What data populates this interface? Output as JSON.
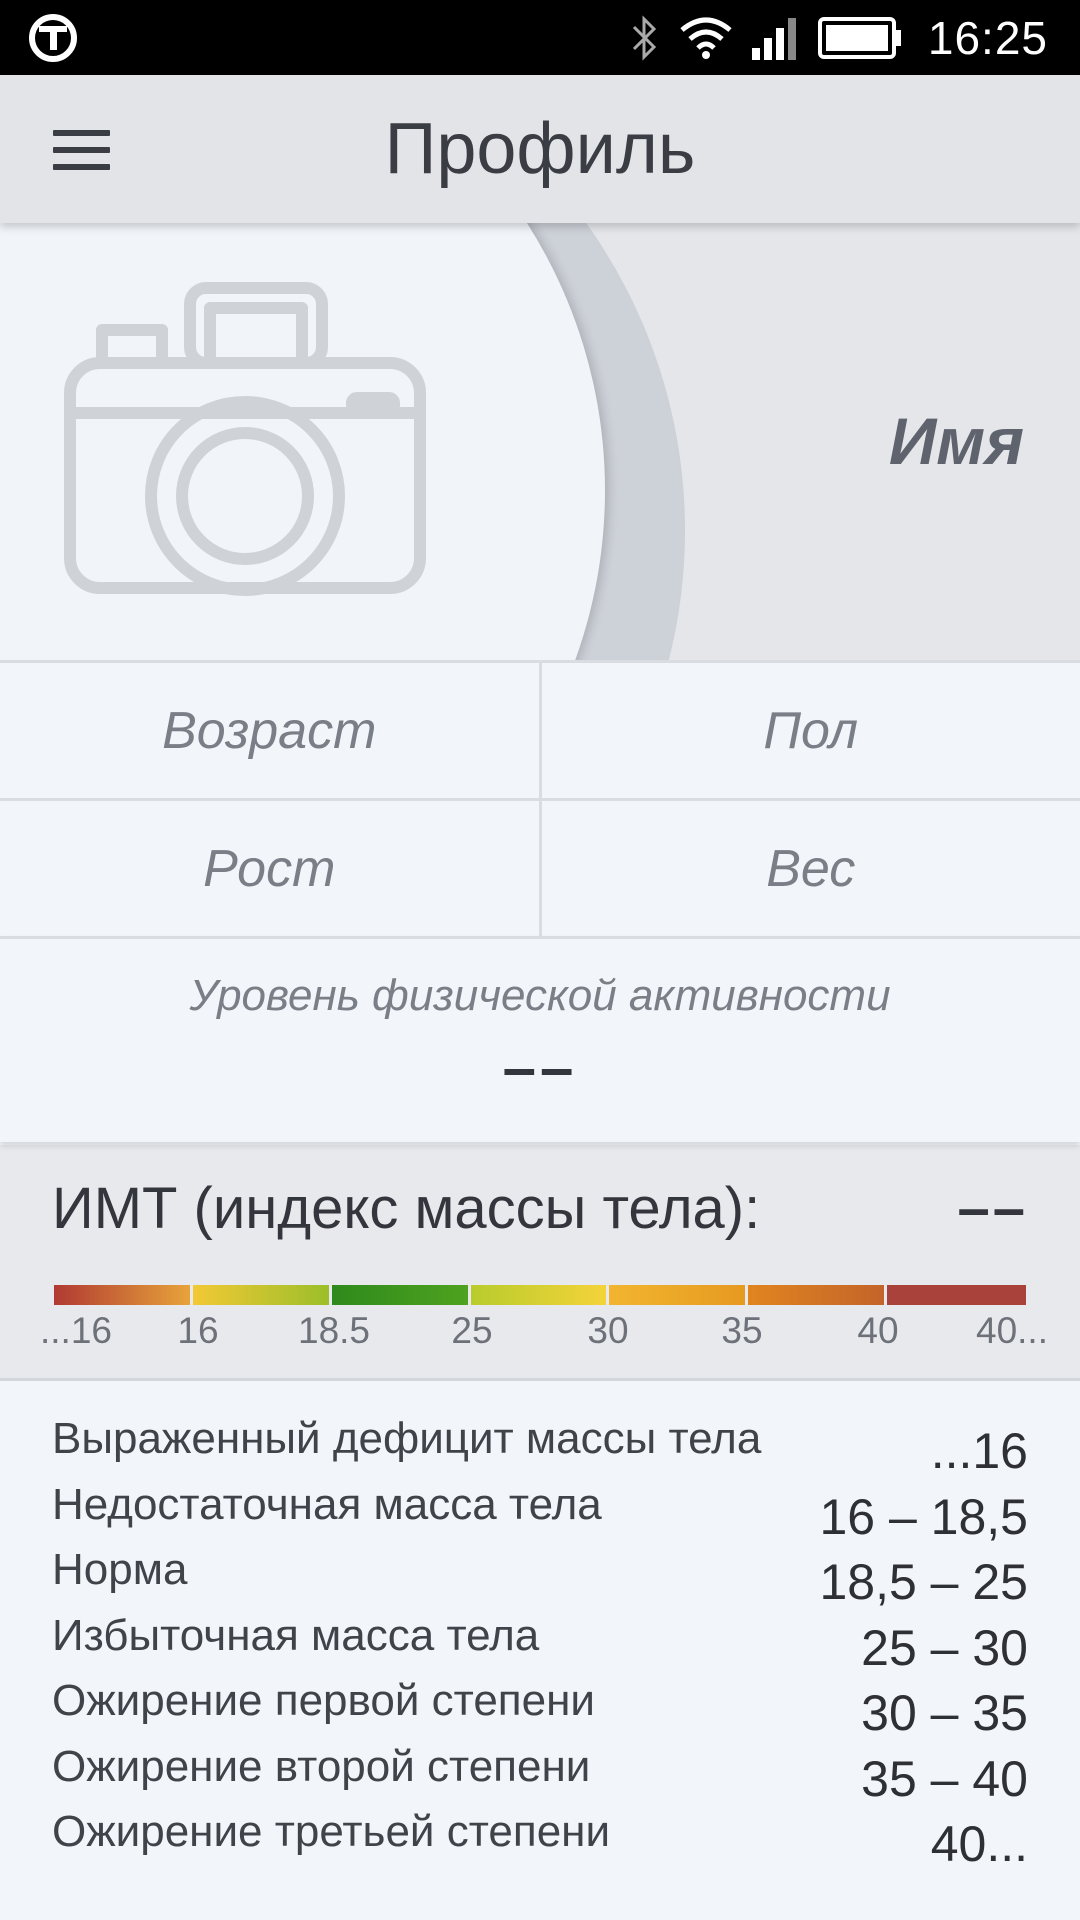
{
  "status_bar": {
    "time": "16:25",
    "icons": [
      "app-logo-icon",
      "bluetooth-icon",
      "wifi-icon",
      "signal-icon",
      "battery-icon"
    ]
  },
  "app_bar": {
    "title": "Профиль",
    "menu_icon": "menu-icon"
  },
  "profile": {
    "photo_icon": "camera-icon",
    "name": "Имя",
    "fields": {
      "age": "Возраст",
      "gender": "Пол",
      "height": "Рост",
      "weight": "Вес"
    },
    "activity": {
      "label": "Уровень физической активности",
      "value": "––"
    }
  },
  "bmi": {
    "title": "ИМТ (индекс массы тела):",
    "value": "––",
    "scale": {
      "ticks": [
        "...16",
        "16",
        "18.5",
        "25",
        "30",
        "35",
        "40",
        "40..."
      ],
      "segments": [
        {
          "from": "#b03a33",
          "to": "#e8a33a"
        },
        {
          "from": "#f2c935",
          "to": "#9bbf2a"
        },
        {
          "from": "#2e8a1c",
          "to": "#4ea21e"
        },
        {
          "from": "#b9cc2c",
          "to": "#f4d33a"
        },
        {
          "from": "#f2b530",
          "to": "#e69a20"
        },
        {
          "from": "#e0851f",
          "to": "#c4642a"
        },
        {
          "from": "#a8423a",
          "to": "#a8423a"
        }
      ]
    },
    "categories": [
      {
        "label": "Выраженный дефицит массы тела",
        "range": "...16"
      },
      {
        "label": "Недостаточная масса тела",
        "range": "16 – 18,5"
      },
      {
        "label": "Норма",
        "range": "18,5 – 25"
      },
      {
        "label": "Избыточная масса тела",
        "range": "25 – 30"
      },
      {
        "label": "Ожирение первой степени",
        "range": "30 – 35"
      },
      {
        "label": "Ожирение второй степени",
        "range": "35 – 40"
      },
      {
        "label": "Ожирение третьей степени",
        "range": "40..."
      }
    ]
  }
}
